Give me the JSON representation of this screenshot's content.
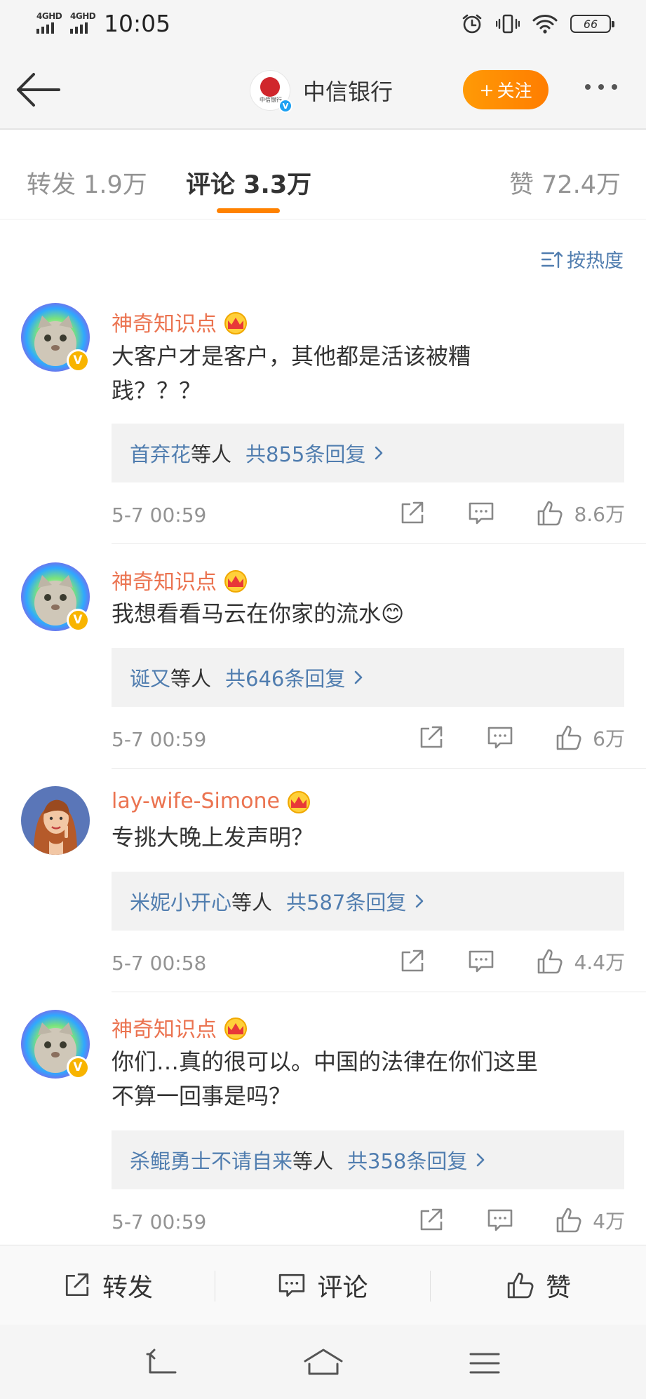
{
  "status_bar": {
    "signal_label_1": "4GHD",
    "signal_label_2": "4GHD",
    "time": "10:05",
    "battery": "66"
  },
  "header": {
    "logo_text": "中信银行",
    "verified_mark": "V",
    "title": "中信银行",
    "follow_label": "关注",
    "follow_plus": "+"
  },
  "tabs": {
    "repost": "转发 1.9万",
    "comment": "评论 3.3万",
    "like": "赞 72.4万"
  },
  "sort_label": "按热度",
  "colors": {
    "accent_orange": "#ff8200",
    "username": "#eb7350",
    "link_blue": "#507daf",
    "verified_yellow": "#f8b400",
    "verified_blue": "#1da1f2"
  },
  "comments": [
    {
      "username": "神奇知识点",
      "text": "大客户才是客户，其他都是活该被糟践？？？",
      "reply_users": "首弃花",
      "reply_etc": "等人",
      "reply_count": "共855条回复",
      "date": "5-7 00:59",
      "likes": "8.6万",
      "avatar_badge": "V"
    },
    {
      "username": "神奇知识点",
      "text": "我想看看马云在你家的流水😊",
      "reply_users": "诞又",
      "reply_etc": "等人",
      "reply_count": "共646条回复",
      "date": "5-7 00:59",
      "likes": "6万",
      "avatar_badge": "V"
    },
    {
      "username": "lay-wife-Simone",
      "text": "专挑大晚上发声明？",
      "reply_users": "米妮小开心",
      "reply_etc": "等人",
      "reply_count": "共587条回复",
      "date": "5-7 00:58",
      "likes": "4.4万",
      "avatar_badge": ""
    },
    {
      "username": "神奇知识点",
      "text": "你们…真的很可以。中国的法律在你们这里不算一回事是吗？",
      "reply_users": "杀鲲勇士不请自来",
      "reply_etc": "等人",
      "reply_count": "共358条回复",
      "date": "5-7 00:59",
      "likes": "4万",
      "avatar_badge": "V"
    }
  ],
  "bottom_bar": {
    "repost": "转发",
    "comment": "评论",
    "like": "赞"
  }
}
